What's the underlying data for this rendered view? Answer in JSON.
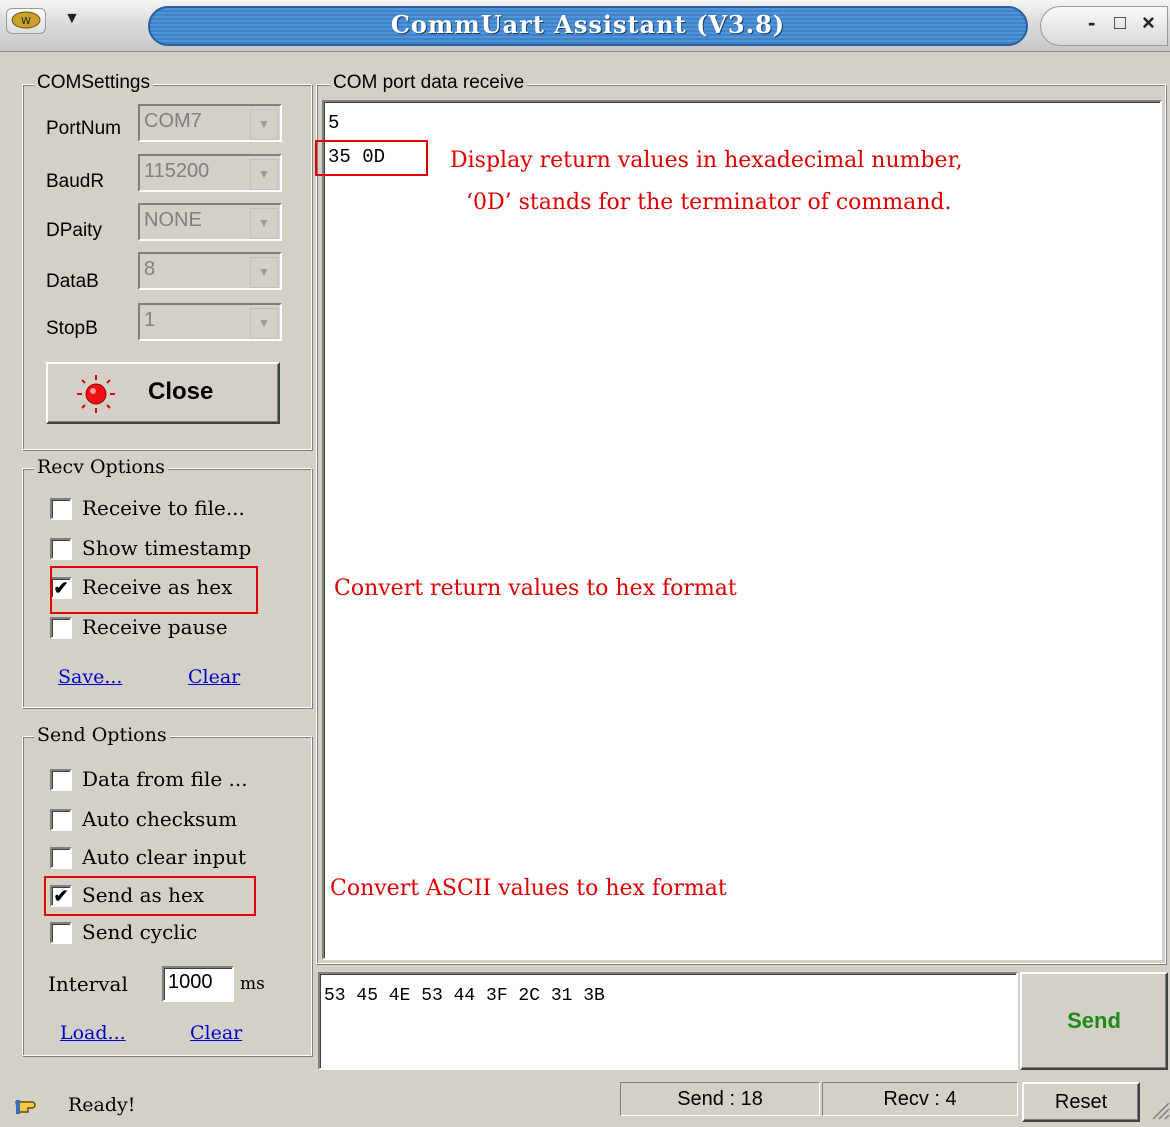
{
  "window": {
    "title": "CommUart Assistant (V3.8)",
    "sysmenu_icon": "app-logo-icon",
    "minimize": "-",
    "maximize": "□",
    "close": "×"
  },
  "com_settings": {
    "legend": "COMSettings",
    "fields": [
      {
        "label": "PortNum",
        "value": "COM7"
      },
      {
        "label": "BaudR",
        "value": "115200"
      },
      {
        "label": "DPaity",
        "value": "NONE"
      },
      {
        "label": "DataB",
        "value": "8"
      },
      {
        "label": "StopB",
        "value": "1"
      }
    ],
    "close_button": "Close"
  },
  "recv_options": {
    "legend": "Recv Options",
    "items": [
      {
        "label": "Receive to file...",
        "checked": false
      },
      {
        "label": "Show timestamp",
        "checked": false
      },
      {
        "label": "Receive as hex",
        "checked": true
      },
      {
        "label": "Receive pause",
        "checked": false
      }
    ],
    "save_link": "Save...",
    "clear_link": "Clear"
  },
  "send_options": {
    "legend": "Send Options",
    "items": [
      {
        "label": "Data from file ...",
        "checked": false
      },
      {
        "label": "Auto checksum",
        "checked": false
      },
      {
        "label": "Auto clear input",
        "checked": false
      },
      {
        "label": "Send as hex",
        "checked": true
      },
      {
        "label": "Send cyclic",
        "checked": false
      }
    ],
    "interval_label": "Interval",
    "interval_value": "1000",
    "interval_unit": "ms",
    "load_link": "Load...",
    "clear_link": "Clear"
  },
  "receive": {
    "legend": "COM port data receive",
    "line1": "5",
    "line2": "35 0D"
  },
  "annotations": {
    "hex_display_1": "Display return values in hexadecimal number,",
    "hex_display_2": "‘0D’ stands for the terminator of command.",
    "recv_hex": "Convert return values to hex format",
    "send_hex": "Convert ASCII values to hex format"
  },
  "send_input": "53 45 4E 53 44 3F 2C 31 3B",
  "send_button": "Send",
  "status": {
    "text": "Ready!",
    "send_count": "Send : 18",
    "recv_count": "Recv : 4",
    "reset": "Reset"
  },
  "colors": {
    "annotation": "#e00000",
    "send_button_text": "#1a8a1a",
    "link": "#0000cc",
    "title_bar": "#4f93d8"
  }
}
